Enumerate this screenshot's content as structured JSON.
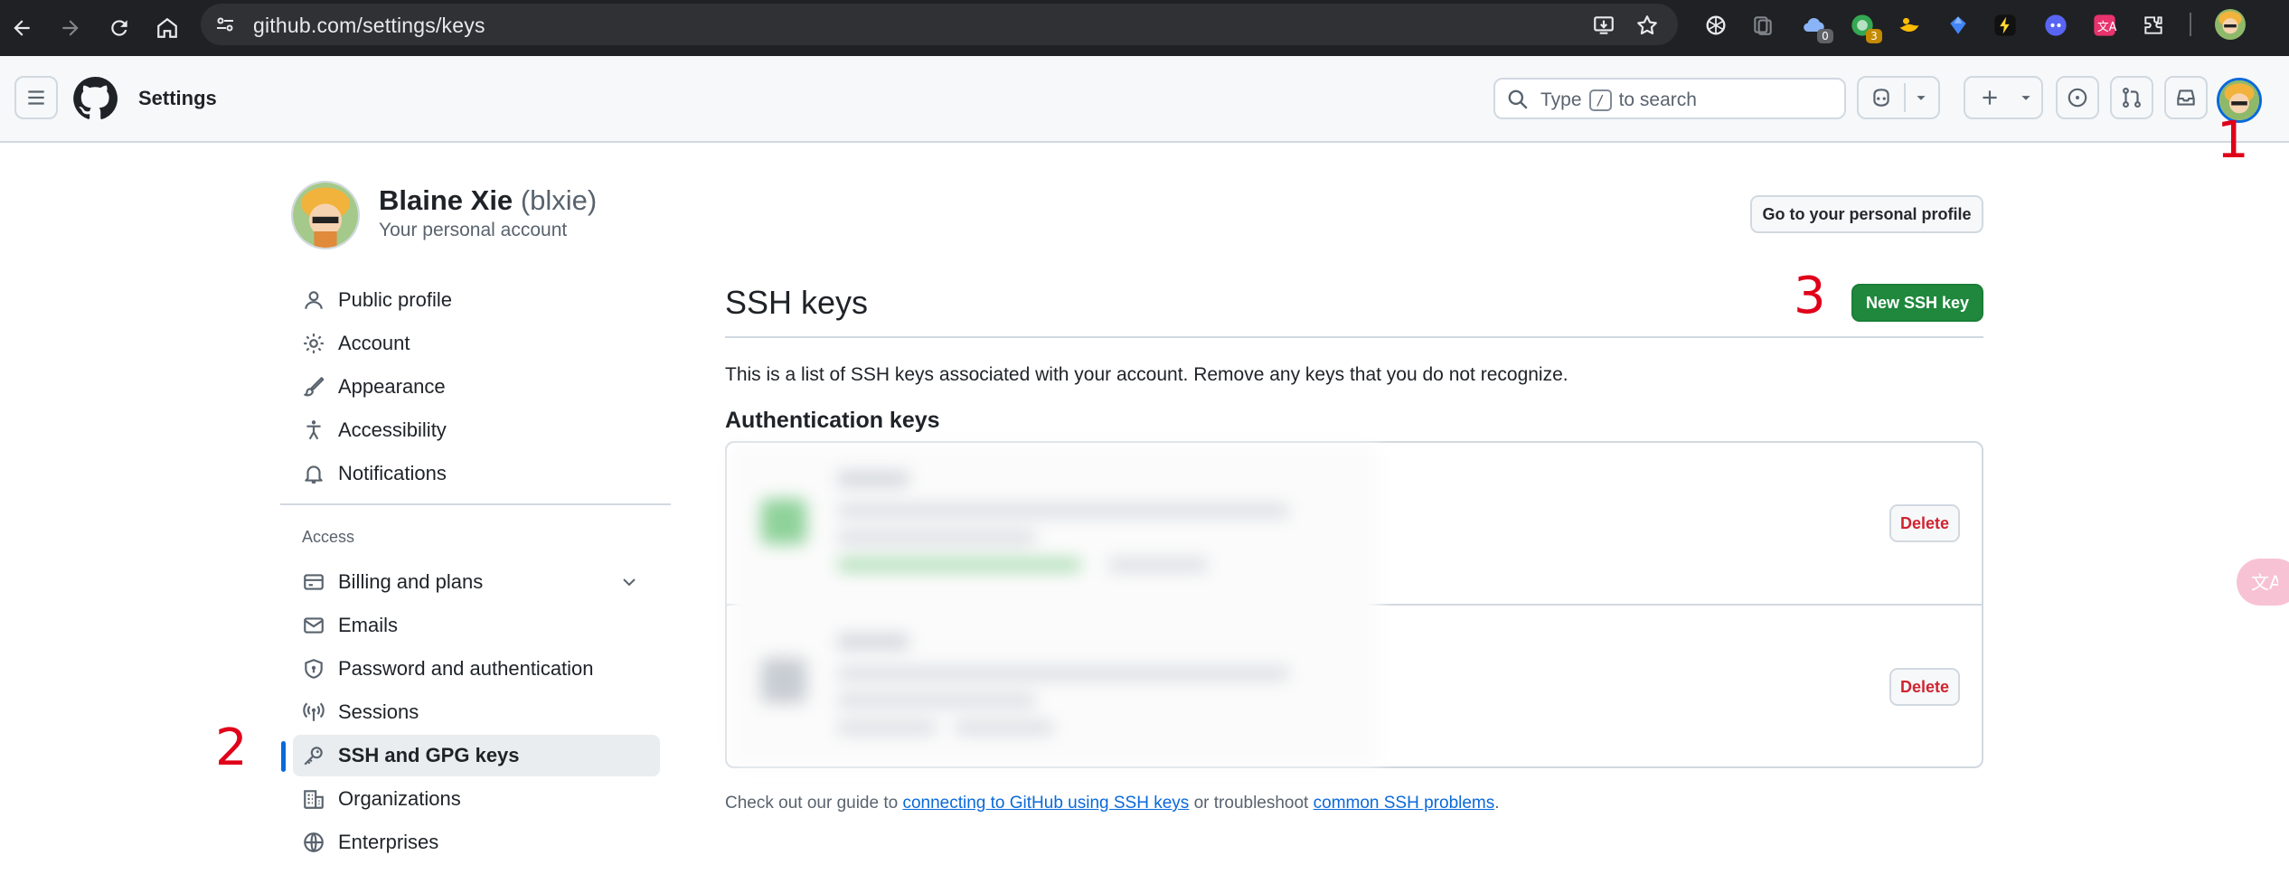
{
  "browser": {
    "url": "github.com/settings/keys",
    "extensions": [
      {
        "icon": "openai-icon"
      },
      {
        "icon": "tab-manager-icon"
      },
      {
        "icon": "cloud-extension-icon",
        "badge": "0",
        "badge_color": "#5f6368"
      },
      {
        "icon": "green-extension-icon",
        "badge": "3",
        "badge_color": "#c58a00"
      },
      {
        "icon": "duck-extension-icon"
      },
      {
        "icon": "blue-gem-extension-icon"
      },
      {
        "icon": "lightning-extension-icon"
      },
      {
        "icon": "discord-extension-icon"
      },
      {
        "icon": "translate-extension-icon"
      },
      {
        "icon": "puzzle-extensions-icon"
      }
    ]
  },
  "header": {
    "title": "Settings",
    "search": {
      "prefix": "Type",
      "shortcut": "/",
      "suffix": "to search"
    }
  },
  "annotations": {
    "one": "1",
    "two": "2",
    "three": "3"
  },
  "profile": {
    "name": "Blaine Xie",
    "login": "(blxie)",
    "subtitle": "Your personal account",
    "go_profile_label": "Go to your personal profile"
  },
  "sidebar": {
    "items": [
      {
        "label": "Public profile",
        "icon": "person-icon"
      },
      {
        "label": "Account",
        "icon": "gear-icon"
      },
      {
        "label": "Appearance",
        "icon": "paintbrush-icon"
      },
      {
        "label": "Accessibility",
        "icon": "accessibility-icon"
      },
      {
        "label": "Notifications",
        "icon": "bell-icon"
      }
    ],
    "group_label": "Access",
    "access_items": [
      {
        "label": "Billing and plans",
        "icon": "credit-card-icon"
      },
      {
        "label": "Emails",
        "icon": "mail-icon"
      },
      {
        "label": "Password and authentication",
        "icon": "shield-lock-icon"
      },
      {
        "label": "Sessions",
        "icon": "broadcast-icon"
      },
      {
        "label": "SSH and GPG keys",
        "icon": "key-icon",
        "active": true
      },
      {
        "label": "Organizations",
        "icon": "organization-icon"
      },
      {
        "label": "Enterprises",
        "icon": "globe-icon"
      }
    ]
  },
  "main": {
    "title": "SSH keys",
    "new_key_label": "New SSH key",
    "description": "This is a list of SSH keys associated with your account. Remove any keys that you do not recognize.",
    "auth_heading": "Authentication keys",
    "keys": [
      {
        "delete_label": "Delete"
      },
      {
        "delete_label": "Delete"
      }
    ],
    "footer": {
      "prefix": "Check out our guide to",
      "link1": "connecting to GitHub using SSH keys",
      "middle": "or troubleshoot",
      "link2": "common SSH problems",
      "suffix": "."
    }
  },
  "colors": {
    "primary_green": "#1f883d",
    "link_blue": "#0969da",
    "danger_red": "#d1242f",
    "annotation_red": "#e0001a"
  }
}
